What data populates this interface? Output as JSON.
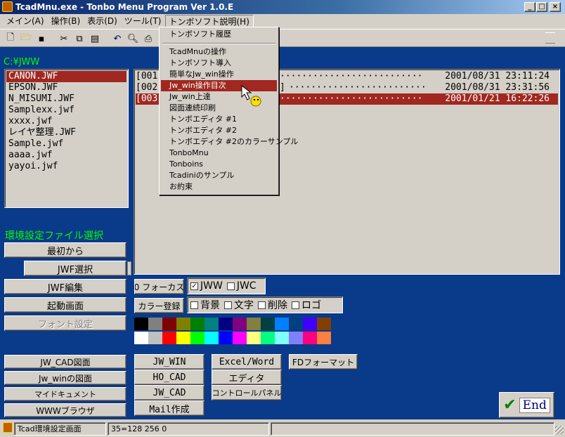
{
  "window": {
    "title": "TcadMnu.exe - Tonbo Menu Program Ver 1.0.E"
  },
  "menubar": [
    {
      "label": "メイン(A)"
    },
    {
      "label": "操作(B)"
    },
    {
      "label": "表示(D)"
    },
    {
      "label": "ツール(T)"
    },
    {
      "label": "トンボソフト説明(H)"
    }
  ],
  "path": "C:¥JWW",
  "files": [
    "CANON.JWF",
    "EPSON.JWF",
    "N_MISUMI.JWF",
    "Samplexx.jwf",
    "xxxx.jwf",
    "レイヤ整理.JWF",
    "Sample.jwf",
    "aaaa.jwf",
    "yayoi.jwf"
  ],
  "records": [
    {
      "id": "[001",
      "mid": "",
      "date": "2001/08/31 23:11:24"
    },
    {
      "id": "[002",
      "mid": "]",
      "date": "2001/08/31 23:31:56"
    },
    {
      "id": "[003",
      "mid": "",
      "date": "2001/01/21 16:22:26"
    }
  ],
  "dropdown": {
    "head": "トンボソフト履歴",
    "items": [
      "TcadMnuの操作",
      "トンボソフト導入",
      "簡単なJw_win操作",
      "Jw_win操作目次",
      "Jw_win上達",
      "図面連続印刷",
      "トンボエディタ #1",
      "トンボエディタ #2",
      "トンボエディタ #2のカラーサンプル",
      "TonboMnu",
      "Tonboins",
      "Tcadiniのサンプル",
      "お約束"
    ]
  },
  "left_panel": {
    "heading": "環境設定ファイル選択",
    "buttons": [
      "最初から",
      "JWF選択",
      "JWF編集",
      "起動画面",
      "フォント設定"
    ]
  },
  "focus": {
    "focus_btn": "0 フォーカス",
    "color_btn": "カラー登録",
    "jww": "JWW",
    "jwc": "JWC",
    "bg": "背景",
    "text": "文字",
    "del": "削除",
    "logo": "ロゴ"
  },
  "palette": {
    "row1": [
      "#000000",
      "#808080",
      "#800000",
      "#808000",
      "#008000",
      "#008080",
      "#000080",
      "#800080",
      "#808040",
      "#004040",
      "#0080ff",
      "#004080",
      "#4000ff",
      "#804000"
    ],
    "row2": [
      "#ffffff",
      "#c0c0c0",
      "#ff0000",
      "#ffff00",
      "#00ff00",
      "#00ffff",
      "#0000ff",
      "#ff00ff",
      "#ffff80",
      "#00ff80",
      "#80ffff",
      "#8080ff",
      "#ff0080",
      "#ff8040"
    ]
  },
  "bottom_left": [
    "JW_CAD図面",
    "Jw_winの図面",
    "マイドキュメント",
    "WWWブラウザ"
  ],
  "launch": {
    "c1": [
      "JW_WIN",
      "HO_CAD",
      "JW_CAD",
      "Mail作成"
    ],
    "c2": [
      "Excel/Word",
      "エディタ",
      "コントロールパネル"
    ],
    "c3": [
      "FDフォーマット"
    ]
  },
  "end_label": "End",
  "status": {
    "s1": "Tcad環境設定画面",
    "s2": "35=128 256 0",
    "s3": ""
  }
}
